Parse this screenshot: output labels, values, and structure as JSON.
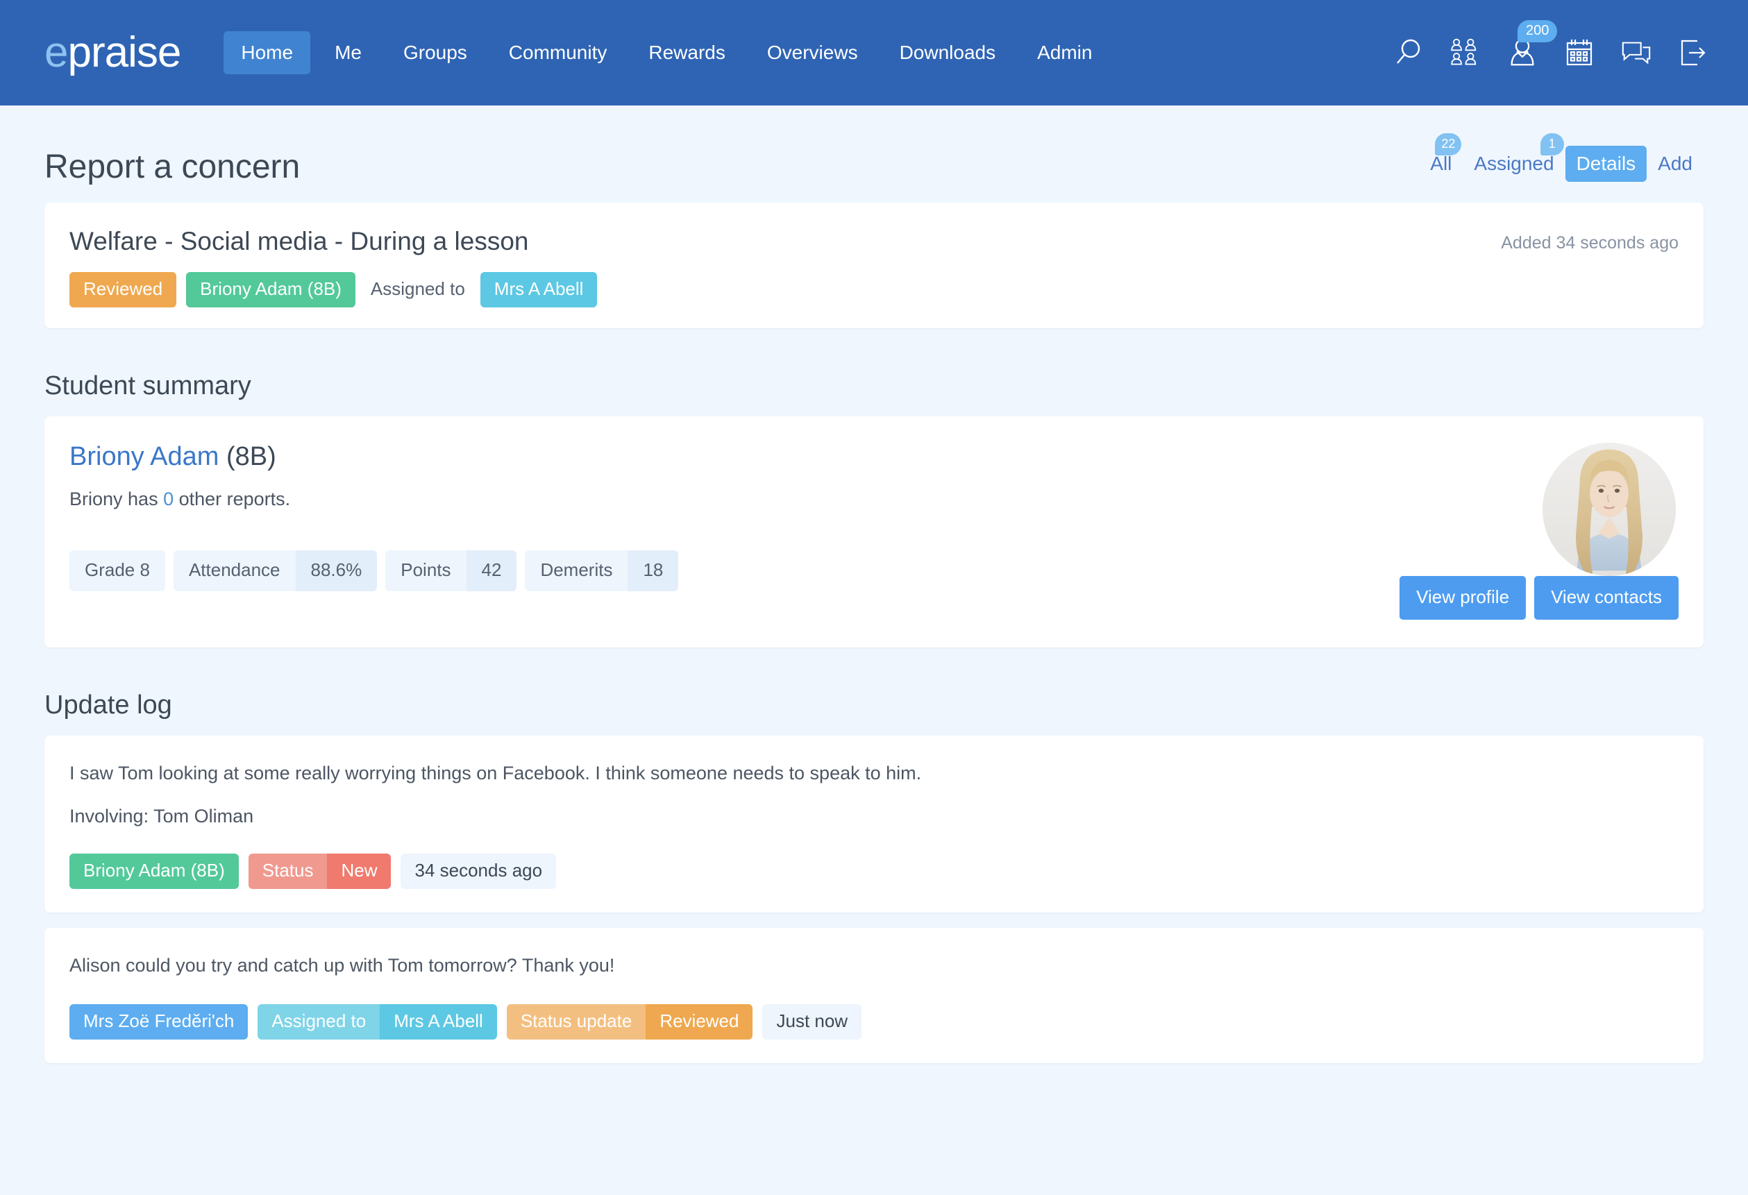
{
  "navbar": {
    "brand_e": "e",
    "brand_rest": "praise",
    "links": [
      {
        "label": "Home",
        "active": true
      },
      {
        "label": "Me",
        "active": false
      },
      {
        "label": "Groups",
        "active": false
      },
      {
        "label": "Community",
        "active": false
      },
      {
        "label": "Rewards",
        "active": false
      },
      {
        "label": "Overviews",
        "active": false
      },
      {
        "label": "Downloads",
        "active": false
      },
      {
        "label": "Admin",
        "active": false
      }
    ],
    "icons": [
      {
        "name": "search-icon",
        "badge": null
      },
      {
        "name": "group-users-icon",
        "badge": null
      },
      {
        "name": "user-profile-icon",
        "badge": "200"
      },
      {
        "name": "calendar-icon",
        "badge": null
      },
      {
        "name": "messages-icon",
        "badge": null
      },
      {
        "name": "logout-icon",
        "badge": null
      }
    ],
    "badge_color": "#5dadf0",
    "bg_color": "#2f64b4"
  },
  "header": {
    "title": "Report a concern",
    "tabs": [
      {
        "label": "All",
        "badge": "22",
        "active": false
      },
      {
        "label": "Assigned",
        "badge": "1",
        "active": false
      },
      {
        "label": "Details",
        "badge": null,
        "active": true
      },
      {
        "label": "Add",
        "badge": null,
        "active": false
      }
    ]
  },
  "concern": {
    "title": "Welfare - Social media - During a lesson",
    "added_time": "Added 34 seconds ago",
    "status_chip": "Reviewed",
    "student_chip": "Briony Adam (8B)",
    "assigned_label": "Assigned to",
    "assignee_chip": "Mrs A Abell"
  },
  "student_summary": {
    "heading": "Student summary",
    "name": "Briony Adam",
    "form": "(8B)",
    "reports_prefix": "Briony has ",
    "reports_count": "0",
    "reports_suffix": " other reports.",
    "stats": [
      {
        "label": "Grade 8",
        "value": null
      },
      {
        "label": "Attendance",
        "value": "88.6%"
      },
      {
        "label": "Points",
        "value": "42"
      },
      {
        "label": "Demerits",
        "value": "18"
      }
    ],
    "view_profile_label": "View profile",
    "view_contacts_label": "View contacts",
    "avatar_name": "student-avatar"
  },
  "update_log": {
    "heading": "Update log",
    "entries": [
      {
        "text": "I saw Tom looking at some really worrying things on Facebook. I think someone needs to speak to him.",
        "sub": "Involving: Tom Oliman",
        "author_chip": "Briony Adam (8B)",
        "group_left": "Status",
        "group_right": "New",
        "time": "34 seconds ago"
      },
      {
        "text": "Alison could you try and catch up with Tom tomorrow? Thank you!",
        "sub": null,
        "author_chip": "Mrs Zoë Fredĕri'ch",
        "assigned_left": "Assigned to",
        "assigned_right": "Mrs A Abell",
        "status_left": "Status update",
        "status_right": "Reviewed",
        "time": "Just now"
      }
    ]
  },
  "colors": {
    "navbar": "#2f64b4",
    "page_bg": "#eff6fd",
    "accent_blue": "#5dadf0",
    "orange": "#efa84f",
    "green": "#53c99a",
    "cyan": "#5cc8e3",
    "red": "#ef7a6d"
  }
}
